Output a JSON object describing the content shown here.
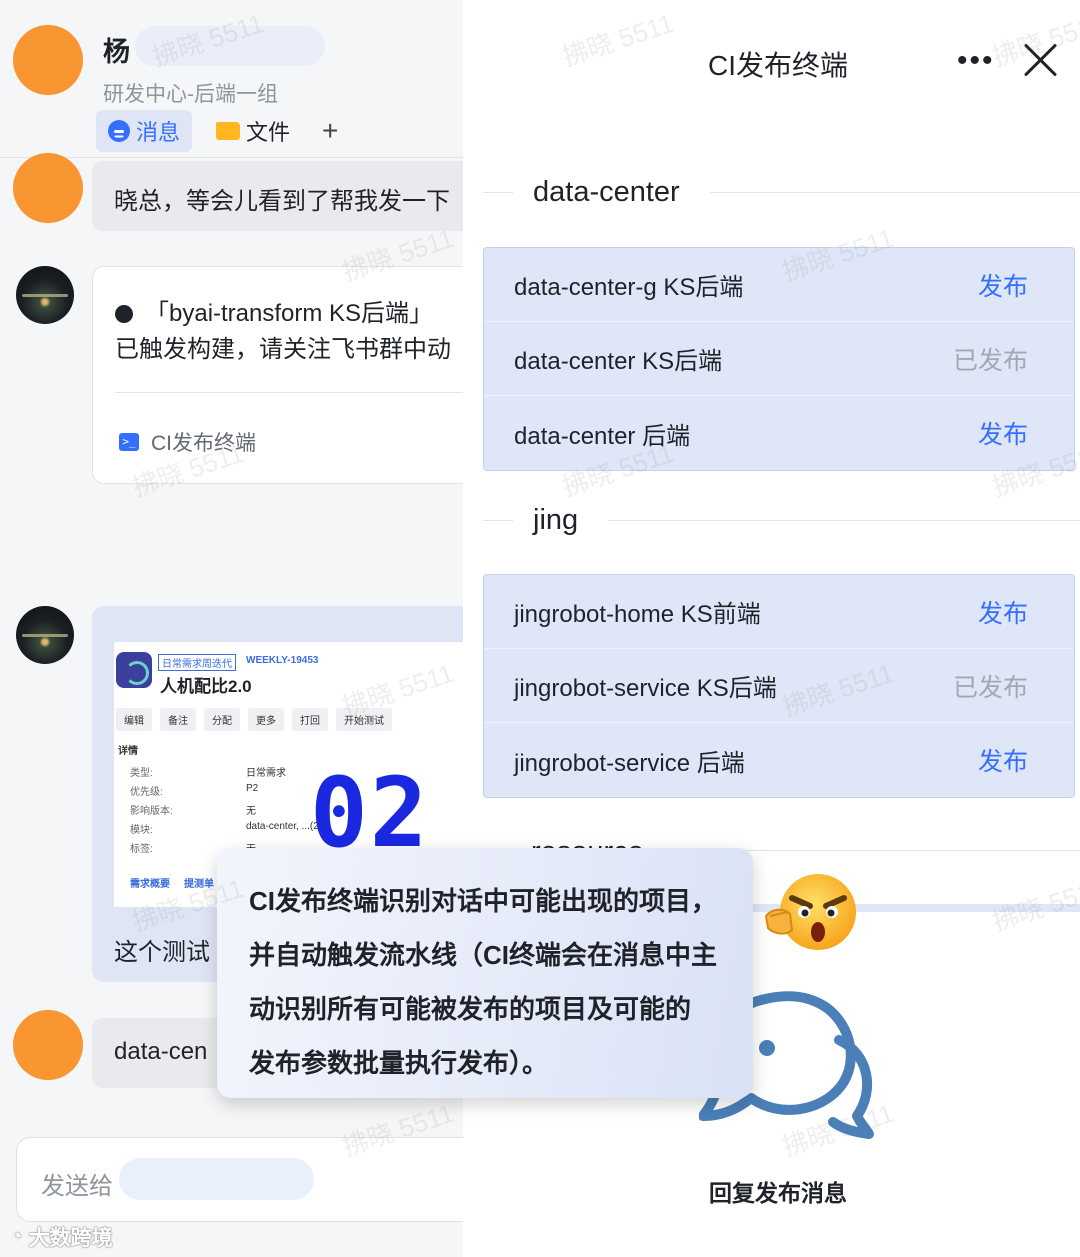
{
  "chat": {
    "name": "杨",
    "department": "研发中心-后端一组",
    "tabs": {
      "messages": "消息",
      "files": "文件",
      "add": "+"
    },
    "message1": "晓总，等会儿看到了帮我发一下",
    "card": {
      "line1": "「byai-transform KS后端」",
      "line2": "已触发构建，请关注飞书群中动",
      "app_label": "CI发布终端"
    },
    "image_card": {
      "tag": "日常需求周迭代",
      "weekly_id": "WEEKLY-19453",
      "title": "人机配比2.0",
      "buttons": [
        "编辑",
        "备注",
        "分配",
        "更多",
        "打回",
        "开始测试"
      ],
      "section": "详情",
      "fields": [
        {
          "label": "类型:",
          "value": "日常需求"
        },
        {
          "label": "优先级:",
          "value": "P2"
        },
        {
          "label": "影响版本:",
          "value": "无"
        },
        {
          "label": "模块:",
          "value": "data-center, ...(2)"
        },
        {
          "label": "标签:",
          "value": "无"
        }
      ],
      "subtabs": [
        "需求概要",
        "提测单"
      ],
      "overlay_number": "02",
      "caption": "这个测试"
    },
    "message3": "data-cen",
    "input_placeholder": "发送给",
    "brand": "大数跨境"
  },
  "panel": {
    "title": "CI发布终端",
    "groups": [
      {
        "name": "data-center",
        "items": [
          {
            "name": "data-center-g KS后端",
            "action": "发布",
            "published": false
          },
          {
            "name": "data-center KS后端",
            "action": "已发布",
            "published": true
          },
          {
            "name": "data-center 后端",
            "action": "发布",
            "published": false
          }
        ]
      },
      {
        "name": "jing",
        "items": [
          {
            "name": "jingrobot-home KS前端",
            "action": "发布",
            "published": false
          },
          {
            "name": "jingrobot-service KS后端",
            "action": "已发布",
            "published": true
          },
          {
            "name": "jingrobot-service 后端",
            "action": "发布",
            "published": false
          }
        ]
      }
    ],
    "partial_group": "resource",
    "reply_label": "回复发布消息"
  },
  "callout": {
    "lines": [
      "CI发布终端识别对话中可能出现的项目，",
      "并自动触发流水线（CI终端会在消息中主",
      "动识别所有可能被发布的项目及可能的",
      "发布参数批量执行发布）。"
    ]
  },
  "watermark": "拂晓 5511",
  "colors": {
    "accent": "#3370ff",
    "published": "#a3a8b0",
    "avatar": "#fa9632",
    "item_bg": "#dfe6f7"
  }
}
